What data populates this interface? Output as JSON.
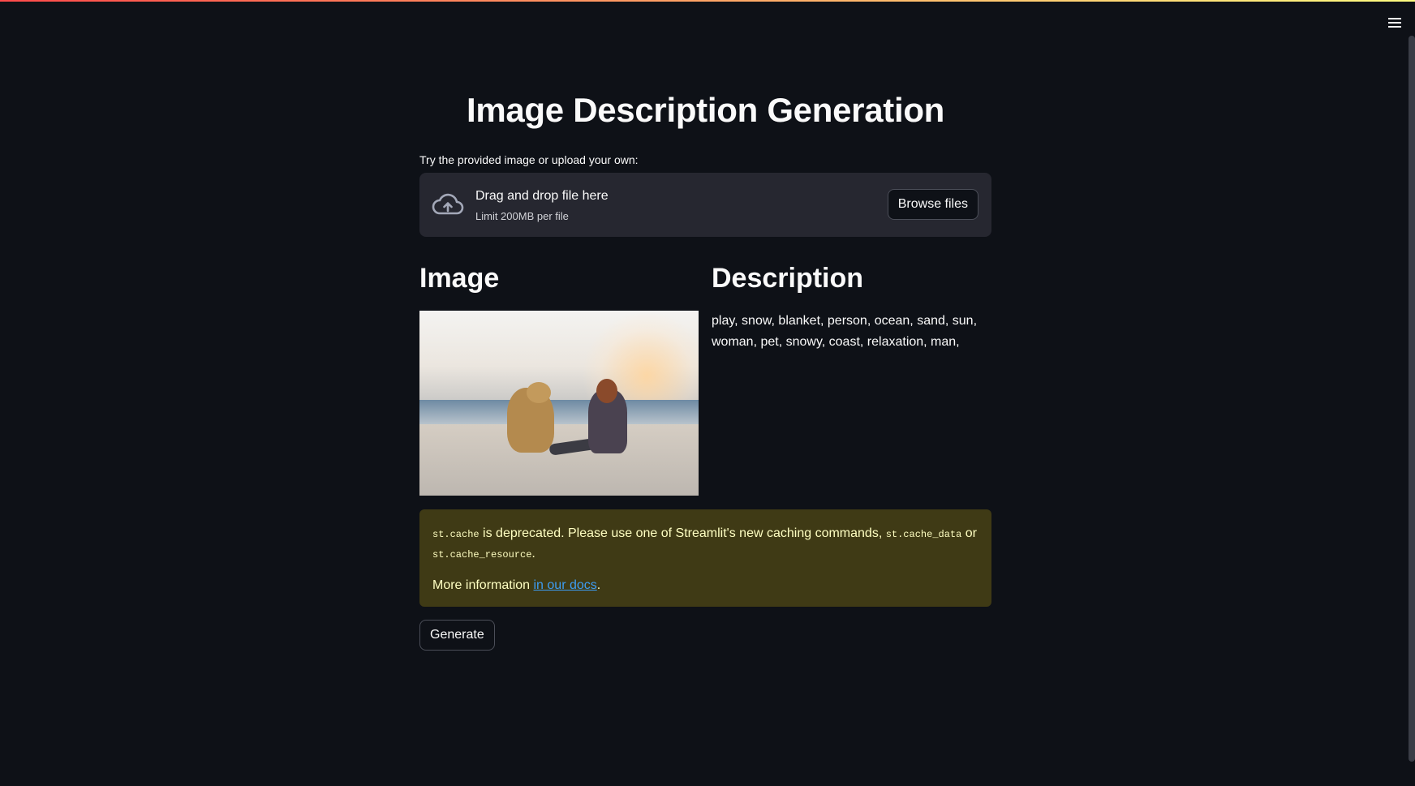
{
  "app": {
    "title": "Image Description Generation",
    "accent_gradient": [
      "#ff4b4b",
      "#fffd80"
    ],
    "menu_icon": "hamburger-menu-icon"
  },
  "uploader": {
    "label": "Try the provided image or upload your own:",
    "drop_title": "Drag and drop file here",
    "drop_subtitle": "Limit 200MB per file",
    "browse_label": "Browse files",
    "icon": "cloud-upload-icon"
  },
  "columns": {
    "image_header": "Image",
    "description_header": "Description",
    "description_text": "play, snow, blanket, person, ocean, sand, sun, woman, pet, snowy, coast, relaxation, man,"
  },
  "warning": {
    "code_1": "st.cache",
    "text_1": " is deprecated. Please use one of Streamlit's new caching commands, ",
    "code_2": "st.cache_data",
    "text_2": " or ",
    "code_3": "st.cache_resource",
    "text_3": ".",
    "more_prefix": "More information ",
    "link_text": "in our docs",
    "more_suffix": ".",
    "bg_color": "#3f3a15",
    "text_color": "#ffffc2"
  },
  "actions": {
    "generate_label": "Generate"
  }
}
